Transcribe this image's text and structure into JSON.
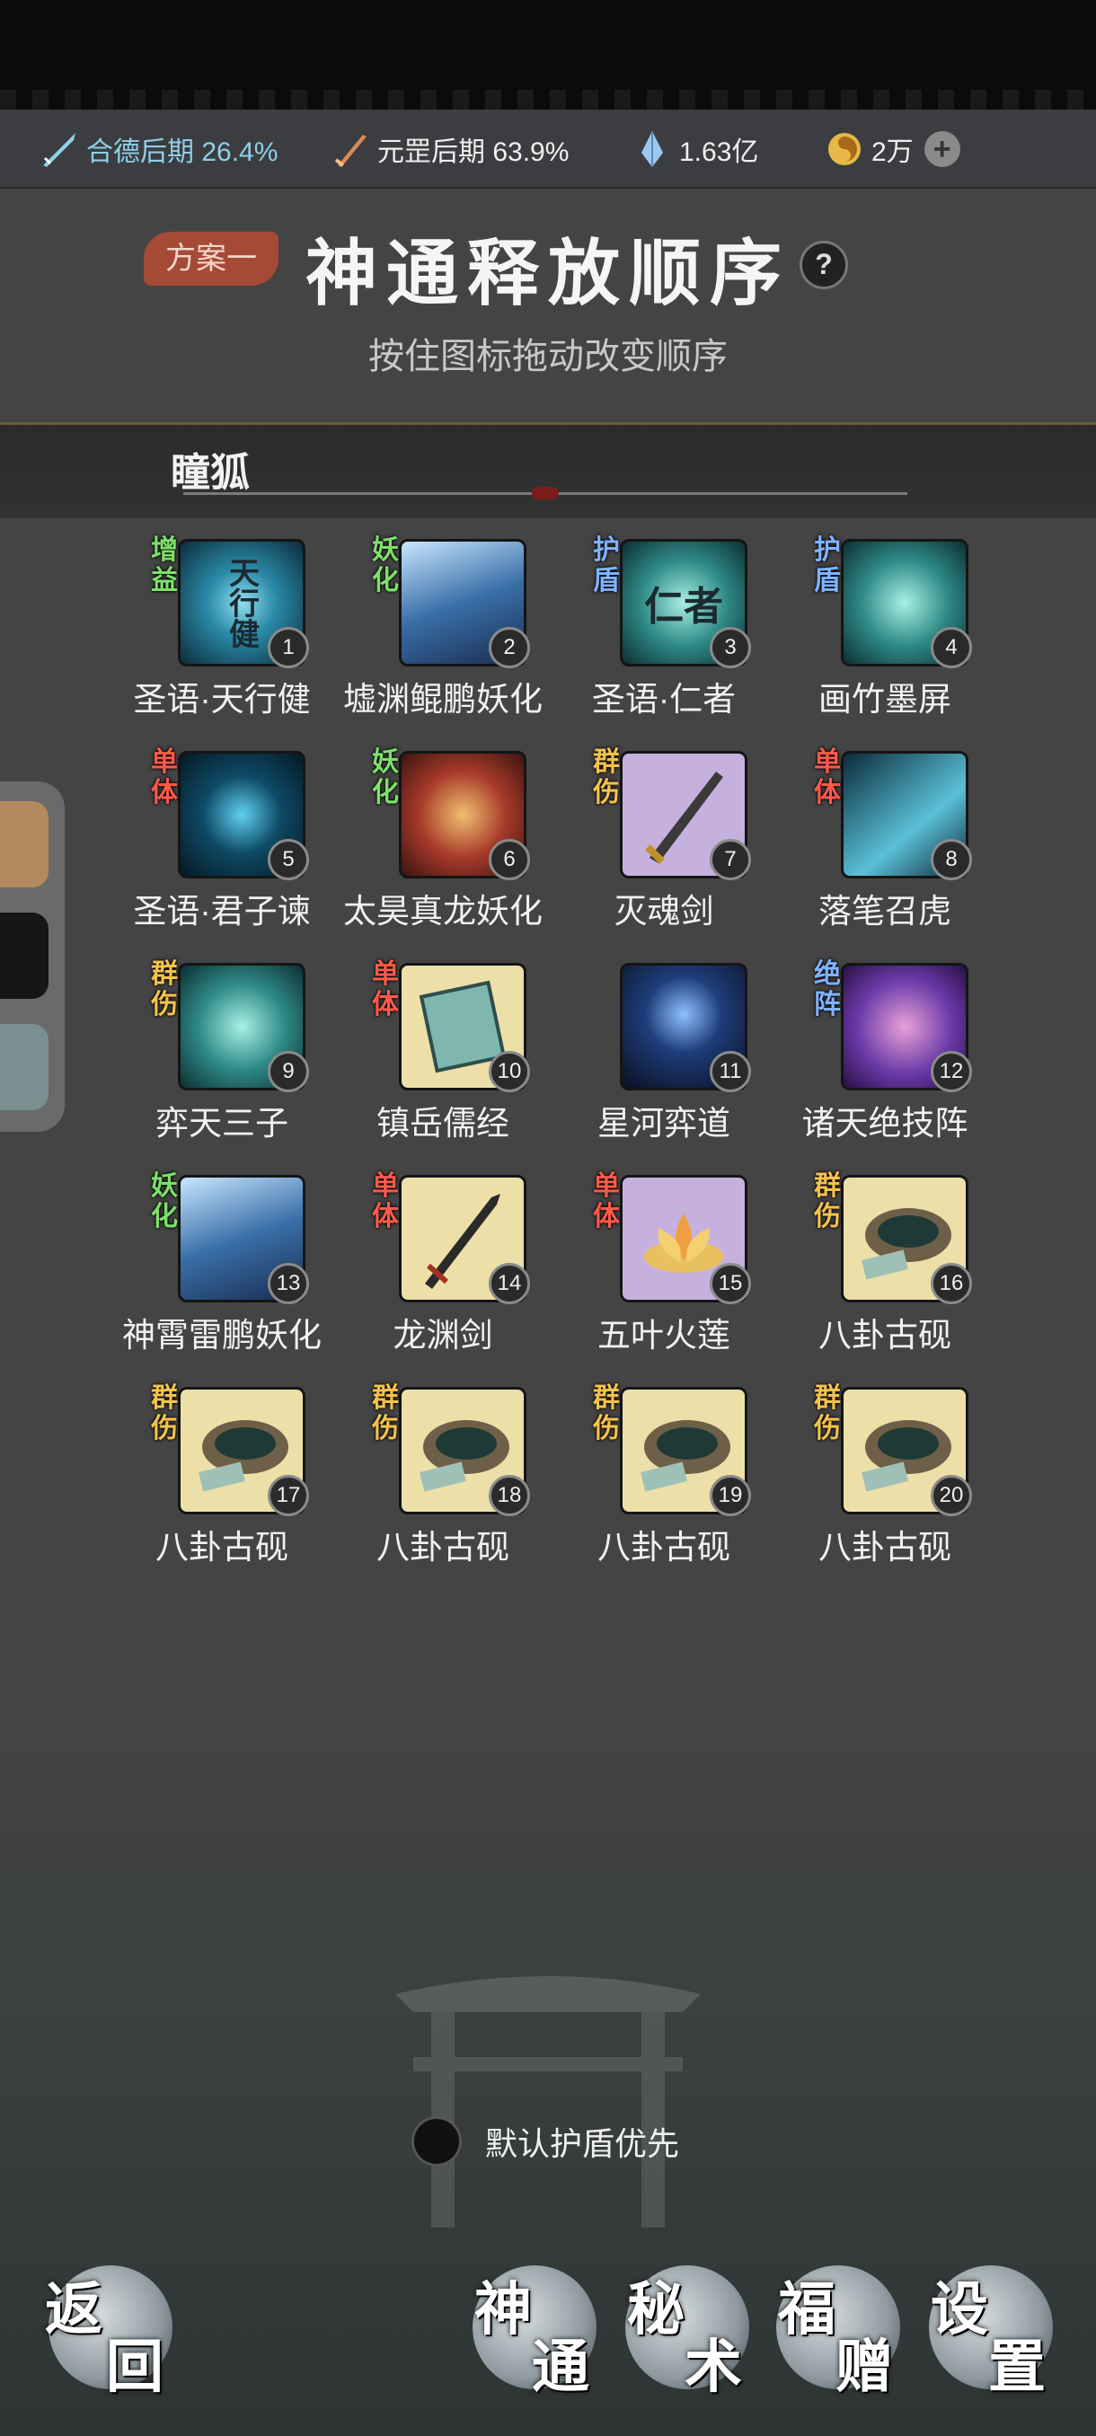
{
  "status": {
    "cultivation": "合德后期 26.4%",
    "weapon_realm": "元罡后期 63.9%",
    "spirit_stones": "1.63亿",
    "currency": "2万"
  },
  "header": {
    "plan_tag": "方案一",
    "title": "神通释放顺序",
    "help": "?",
    "subtitle": "按住图标拖动改变顺序"
  },
  "section": {
    "name": "瞳狐"
  },
  "skills": [
    {
      "tag": "增益",
      "glyph": "天行健",
      "num": "1",
      "name": "圣语·天行健"
    },
    {
      "tag": "妖化",
      "glyph": "",
      "num": "2",
      "name": "墟渊鲲鹏妖化"
    },
    {
      "tag": "护盾",
      "glyph": "仁者",
      "num": "3",
      "name": "圣语·仁者"
    },
    {
      "tag": "护盾",
      "glyph": "",
      "num": "4",
      "name": "画竹墨屏"
    },
    {
      "tag": "单体",
      "glyph": "",
      "num": "5",
      "name": "圣语·君子谏"
    },
    {
      "tag": "妖化",
      "glyph": "",
      "num": "6",
      "name": "太昊真龙妖化"
    },
    {
      "tag": "群伤",
      "glyph": "",
      "num": "7",
      "name": "灭魂剑"
    },
    {
      "tag": "单体",
      "glyph": "",
      "num": "8",
      "name": "落笔召虎"
    },
    {
      "tag": "群伤",
      "glyph": "",
      "num": "9",
      "name": "弈天三子"
    },
    {
      "tag": "单体",
      "glyph": "",
      "num": "10",
      "name": "镇岳儒经"
    },
    {
      "tag": "",
      "glyph": "",
      "num": "11",
      "name": "星河弈道"
    },
    {
      "tag": "绝阵",
      "glyph": "",
      "num": "12",
      "name": "诸天绝技阵"
    },
    {
      "tag": "妖化",
      "glyph": "",
      "num": "13",
      "name": "神霄雷鹏妖化"
    },
    {
      "tag": "单体",
      "glyph": "",
      "num": "14",
      "name": "龙渊剑"
    },
    {
      "tag": "单体",
      "glyph": "",
      "num": "15",
      "name": "五叶火莲"
    },
    {
      "tag": "群伤",
      "glyph": "",
      "num": "16",
      "name": "八卦古砚"
    },
    {
      "tag": "群伤",
      "glyph": "",
      "num": "17",
      "name": "八卦古砚"
    },
    {
      "tag": "群伤",
      "glyph": "",
      "num": "18",
      "name": "八卦古砚"
    },
    {
      "tag": "群伤",
      "glyph": "",
      "num": "19",
      "name": "八卦古砚"
    },
    {
      "tag": "群伤",
      "glyph": "",
      "num": "20",
      "name": "八卦古砚"
    }
  ],
  "default_option": {
    "label": "默认护盾优先"
  },
  "nav": {
    "back": [
      "返",
      "回"
    ],
    "skills": [
      "神",
      "通"
    ],
    "secret": [
      "秘",
      "术"
    ],
    "blessing": [
      "福",
      "赠"
    ],
    "settings": [
      "设",
      "置"
    ]
  }
}
